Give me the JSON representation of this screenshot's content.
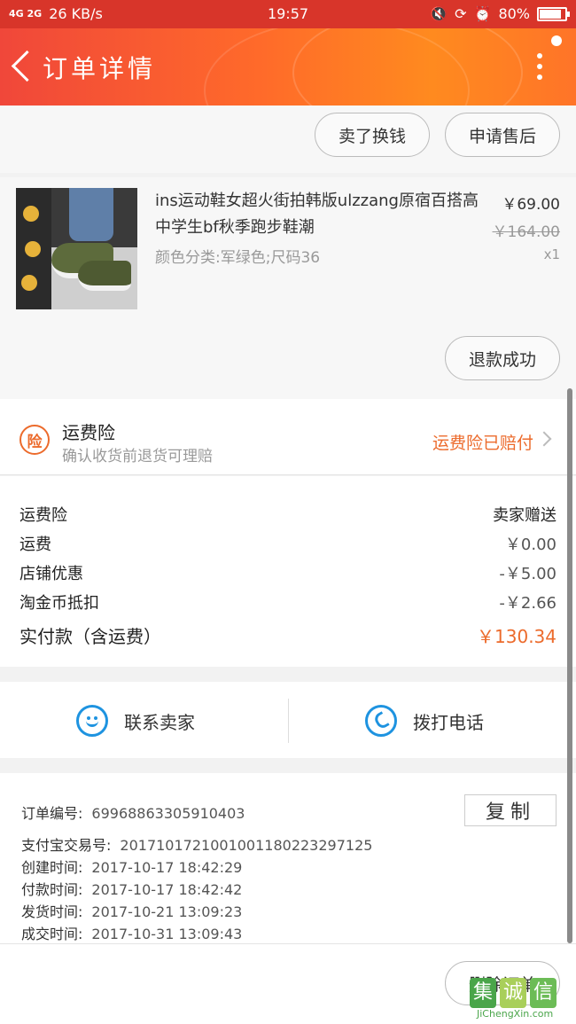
{
  "status_bar": {
    "network": "4G 2G",
    "speed": "26 KB/s",
    "time": "19:57",
    "battery": "80%"
  },
  "header": {
    "title": "订单详情"
  },
  "top_actions": {
    "btn_swap": "卖了换钱",
    "btn_aftersale": "申请售后"
  },
  "product": {
    "title": "ins运动鞋女超火街拍韩版ulzzang原宿百搭高中学生bf秋季跑步鞋潮",
    "spec": "颜色分类:军绿色;尺码36",
    "price": "￥69.00",
    "original_price": "￥164.00",
    "quantity": "x1",
    "refund_status": "退款成功"
  },
  "insurance": {
    "icon_text": "险",
    "title": "运费险",
    "subtitle": "确认收货前退货可理赔",
    "status": "运费险已赔付"
  },
  "fees": [
    {
      "label": "运费险",
      "value": "卖家赠送"
    },
    {
      "label": "运费",
      "value": "￥0.00"
    },
    {
      "label": "店铺优惠",
      "value": "-￥5.00"
    },
    {
      "label": "淘金币抵扣",
      "value": "-￥2.66"
    }
  ],
  "total": {
    "label": "实付款（含运费）",
    "value": "￥130.34"
  },
  "contact": {
    "seller": "联系卖家",
    "phone": "拨打电话"
  },
  "order_info": {
    "order_no_label": "订单编号:",
    "order_no": "69968863305910403",
    "copy": "复制",
    "alipay_label": "支付宝交易号:",
    "alipay_no": "2017101721001001180223297125",
    "created_label": "创建时间:",
    "created": "2017-10-17 18:42:29",
    "paid_label": "付款时间:",
    "paid": "2017-10-17 18:42:42",
    "shipped_label": "发货时间:",
    "shipped": "2017-10-21 13:09:23",
    "completed_label": "成交时间:",
    "completed": "2017-10-31 13:09:43"
  },
  "bottom": {
    "delete_order": "删除订单"
  },
  "watermark": {
    "logo": [
      "集",
      "诚",
      "信"
    ],
    "text": "JiChengXin.com"
  },
  "colors": {
    "accent": "#ec6b2c",
    "header_start": "#f0473a",
    "header_end": "#ff8a1f",
    "link_blue": "#1e93e0"
  }
}
